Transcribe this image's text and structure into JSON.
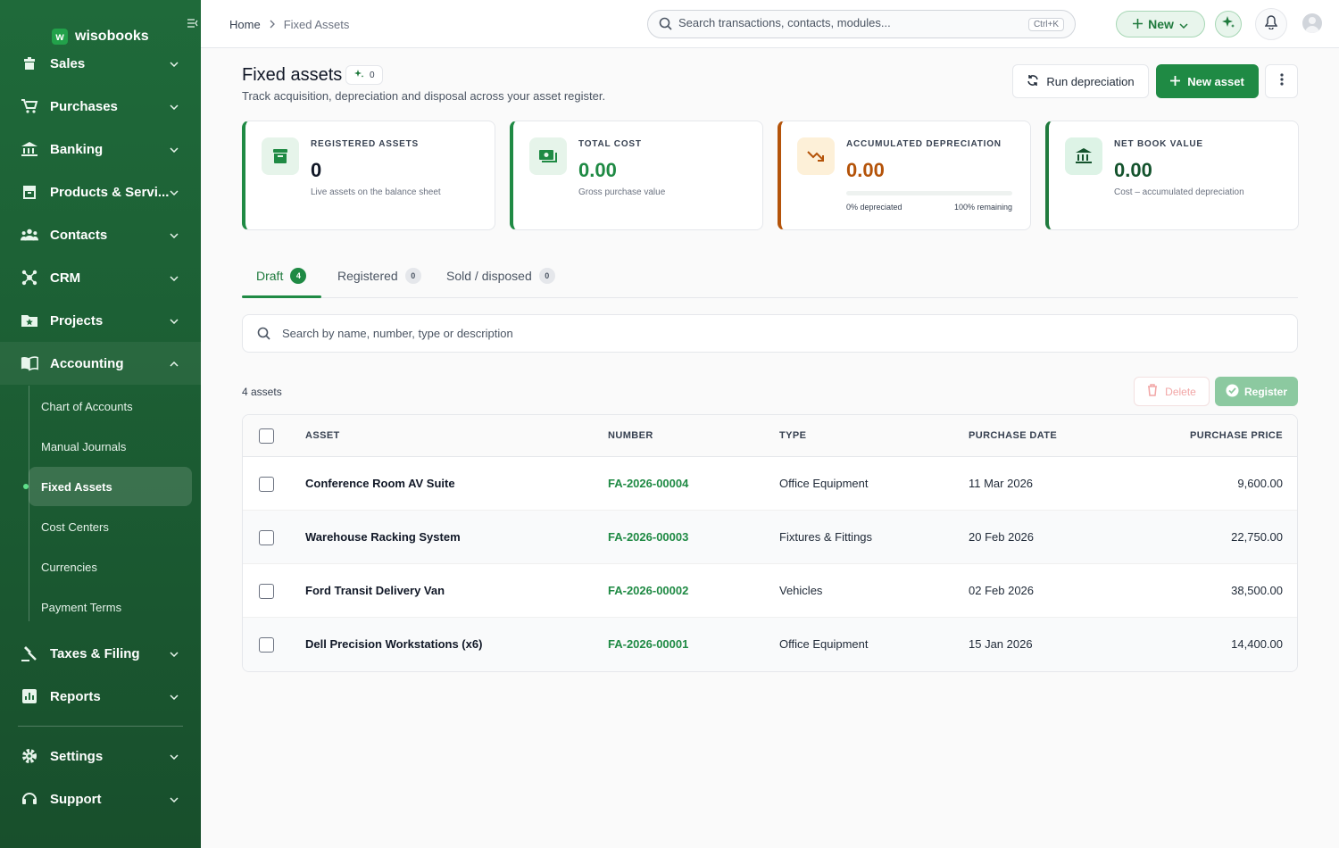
{
  "brand": {
    "name": "wisobooks",
    "logo_letter": "w"
  },
  "sidebar": {
    "items": [
      {
        "label": "Sales",
        "icon": "sales-icon"
      },
      {
        "label": "Purchases",
        "icon": "cart-icon"
      },
      {
        "label": "Banking",
        "icon": "bank-icon"
      },
      {
        "label": "Products & Servi...",
        "icon": "box-icon"
      },
      {
        "label": "Contacts",
        "icon": "people-icon"
      },
      {
        "label": "CRM",
        "icon": "network-icon"
      },
      {
        "label": "Projects",
        "icon": "folder-star-icon"
      },
      {
        "label": "Accounting",
        "icon": "book-icon",
        "expanded": true
      },
      {
        "label": "Taxes & Filing",
        "icon": "gavel-icon"
      },
      {
        "label": "Reports",
        "icon": "chart-icon"
      },
      {
        "label": "Settings",
        "icon": "gear-icon"
      },
      {
        "label": "Support",
        "icon": "headset-icon"
      }
    ],
    "accounting_sub": [
      {
        "label": "Chart of Accounts"
      },
      {
        "label": "Manual Journals"
      },
      {
        "label": "Fixed Assets",
        "active": true
      },
      {
        "label": "Cost Centers"
      },
      {
        "label": "Currencies"
      },
      {
        "label": "Payment Terms"
      }
    ]
  },
  "topbar": {
    "breadcrumb": {
      "home": "Home",
      "current": "Fixed Assets"
    },
    "search_placeholder": "Search transactions, contacts, modules...",
    "shortcut": "Ctrl+K",
    "new_label": "New"
  },
  "page": {
    "title": "Fixed assets",
    "ai_count": "0",
    "subtitle": "Track acquisition, depreciation and disposal across your asset register.",
    "run_label": "Run depreciation",
    "new_asset_label": "New asset"
  },
  "cards": [
    {
      "label": "REGISTERED ASSETS",
      "value": "0",
      "sub": "Live assets on the balance sheet",
      "accent": "#1f8a44",
      "value_color": "#111827",
      "icon": "archive-icon"
    },
    {
      "label": "TOTAL COST",
      "value": "0.00",
      "sub": "Gross purchase value",
      "accent": "#1f8a44",
      "value_color": "#1f8a44",
      "icon": "cash-icon"
    },
    {
      "label": "ACCUMULATED DEPRECIATION",
      "value": "0.00",
      "accent": "#b45309",
      "value_color": "#b45309",
      "icon": "trending-down-icon",
      "progress_percent": 0,
      "progress_left": "0% depreciated",
      "progress_right": "100% remaining"
    },
    {
      "label": "NET BOOK VALUE",
      "value": "0.00",
      "sub": "Cost – accumulated depreciation",
      "accent": "#1f7a3d",
      "value_color": "#14532d",
      "icon": "institution-icon"
    }
  ],
  "tabs": [
    {
      "label": "Draft",
      "count": "4",
      "active": true
    },
    {
      "label": "Registered",
      "count": "0"
    },
    {
      "label": "Sold / disposed",
      "count": "0"
    }
  ],
  "table_search_placeholder": "Search by name, number, type or description",
  "count_label": "4 assets",
  "actions": {
    "delete": "Delete",
    "register": "Register"
  },
  "table": {
    "columns": [
      "ASSET",
      "NUMBER",
      "TYPE",
      "PURCHASE DATE",
      "PURCHASE PRICE"
    ],
    "rows": [
      {
        "asset": "Conference Room AV Suite",
        "number": "FA-2026-00004",
        "type": "Office Equipment",
        "date": "11 Mar 2026",
        "price": "9,600.00"
      },
      {
        "asset": "Warehouse Racking System",
        "number": "FA-2026-00003",
        "type": "Fixtures & Fittings",
        "date": "20 Feb 2026",
        "price": "22,750.00"
      },
      {
        "asset": "Ford Transit Delivery Van",
        "number": "FA-2026-00002",
        "type": "Vehicles",
        "date": "02 Feb 2026",
        "price": "38,500.00"
      },
      {
        "asset": "Dell Precision Workstations (x6)",
        "number": "FA-2026-00001",
        "type": "Office Equipment",
        "date": "15 Jan 2026",
        "price": "14,400.00"
      }
    ]
  }
}
